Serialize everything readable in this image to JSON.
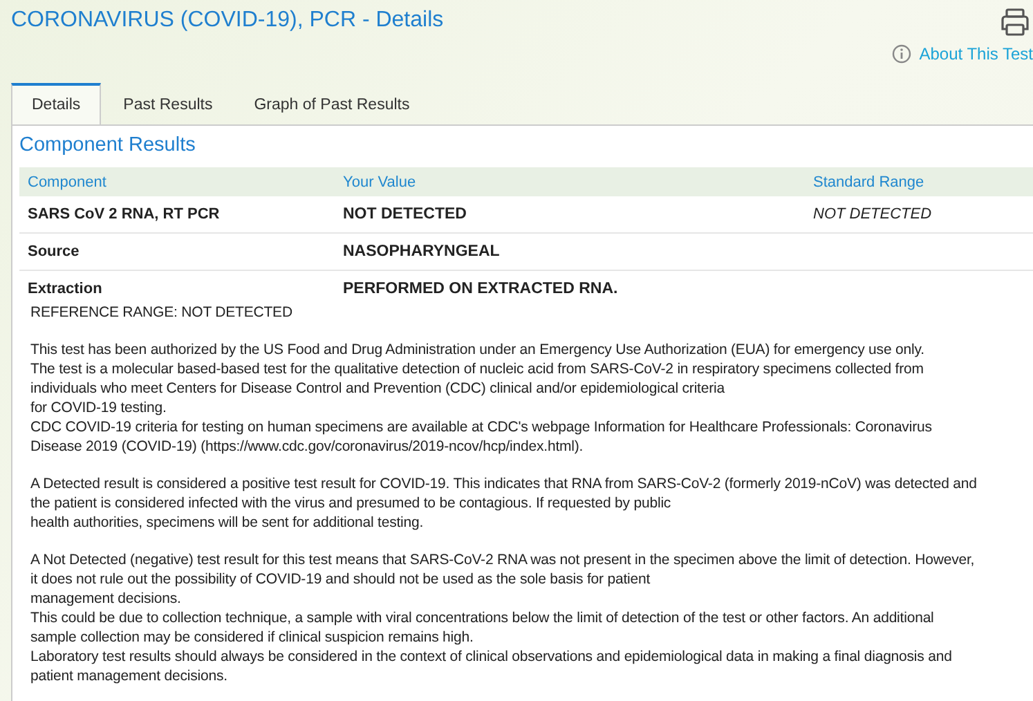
{
  "header": {
    "title": "CORONAVIRUS (COVID-19), PCR - Details",
    "about_link": "About This Test"
  },
  "tabs": [
    {
      "label": "Details",
      "selected": true
    },
    {
      "label": "Past Results",
      "selected": false
    },
    {
      "label": "Graph of Past Results",
      "selected": false
    }
  ],
  "section_title": "Component Results",
  "table": {
    "columns": [
      "Component",
      "Your Value",
      "Standard Range"
    ],
    "rows": [
      {
        "component": "SARS CoV 2 RNA, RT PCR",
        "value": "NOT DETECTED",
        "range": "NOT DETECTED"
      },
      {
        "component": "Source",
        "value": "NASOPHARYNGEAL",
        "range": ""
      },
      {
        "component": "Extraction",
        "value": "PERFORMED ON EXTRACTED RNA.",
        "range": ""
      }
    ]
  },
  "reference_range": "REFERENCE RANGE: NOT DETECTED",
  "paragraphs": [
    [
      "This test has been authorized by the US Food and Drug Administration under an Emergency Use Authorization (EUA) for emergency use only.",
      "The test is a molecular based-based test for the qualitative detection of nucleic acid from SARS-CoV-2 in respiratory specimens collected from",
      "individuals who meet Centers for Disease Control and Prevention (CDC) clinical and/or epidemiological criteria",
      "for COVID-19 testing.",
      "CDC COVID-19 criteria for testing on human specimens are available at CDC's webpage Information for Healthcare Professionals: Coronavirus",
      "Disease 2019 (COVID-19) (https://www.cdc.gov/coronavirus/2019-ncov/hcp/index.html)."
    ],
    [
      "A Detected result is considered a positive test result for COVID-19. This indicates that RNA from SARS-CoV-2 (formerly 2019-nCoV) was detected and",
      "the patient is considered infected with the virus and presumed to be contagious. If requested by public",
      "health authorities, specimens will be sent for additional testing."
    ],
    [
      "A Not Detected (negative) test result for this test means that SARS-CoV-2 RNA was not present in the specimen above the limit of detection. However,",
      "it does not rule out the possibility of COVID-19 and should not be used as the sole basis for patient",
      "management decisions.",
      "This could be due to collection technique, a sample with viral concentrations below the limit of detection of the test or other factors. An additional",
      "sample collection may be considered if clinical suspicion remains high.",
      "Laboratory test results should always be considered in the context of clinical observations and epidemiological data in making a final diagnosis and",
      "patient management decisions."
    ]
  ]
}
